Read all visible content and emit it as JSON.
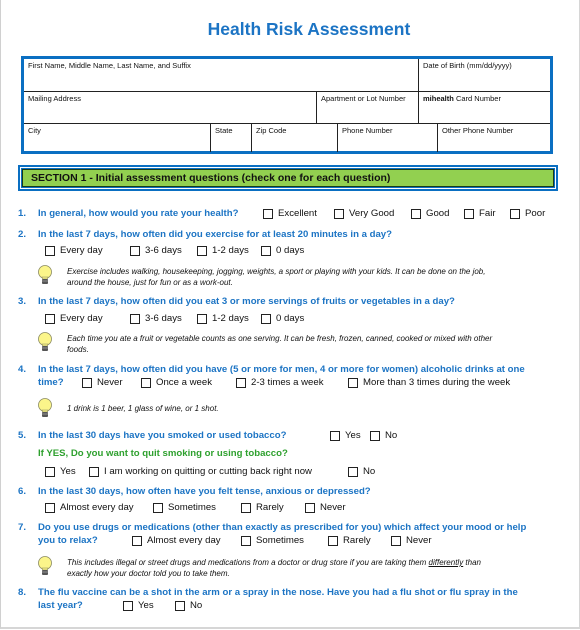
{
  "title": "Health Risk Assessment",
  "info_fields": {
    "full_name": "First Name, Middle Name, Last Name, and Suffix",
    "dob": "Date of Birth (mm/dd/yyyy)",
    "mailing_address": "Mailing Address",
    "apartment": "Apartment or Lot Number",
    "card_number_brand": "mihealth",
    "card_number_rest": "Card Number",
    "city": "City",
    "state": "State",
    "zip": "Zip Code",
    "phone": "Phone Number",
    "other_phone": "Other Phone Number"
  },
  "section": {
    "title": "SECTION 1 - Initial assessment questions (check one for each question)"
  },
  "questions": [
    {
      "num": "1.",
      "text": "In general, how would you rate your health?",
      "options": [
        "Excellent",
        "Very Good",
        "Good",
        "Fair",
        "Poor"
      ]
    },
    {
      "num": "2.",
      "text": "In the last 7 days, how often did you exercise for at least 20 minutes in a day?",
      "options": [
        "Every day",
        "3-6 days",
        "1-2 days",
        "0 days"
      ],
      "tip": [
        "Exercise includes walking, housekeeping, jogging, weights, a sport or playing with your kids.  It can be done on the job,",
        "around the house, just for fun or as a work-out."
      ]
    },
    {
      "num": "3.",
      "text": "In the last 7 days, how often did you eat 3 or more servings of fruits or vegetables in a day?",
      "options": [
        "Every day",
        "3-6 days",
        "1-2 days",
        "0 days"
      ],
      "tip": [
        "Each time you ate a fruit or vegetable counts as one serving.  It can be fresh, frozen, canned, cooked or mixed with other",
        "foods."
      ]
    },
    {
      "num": "4.",
      "text_line1": "In the last 7 days, how often did you have (5 or more for men, 4 or more for women) alcoholic drinks at one",
      "text_line2": "time?",
      "options": [
        "Never",
        "Once a week",
        "2-3 times a week",
        "More than 3 times during the week"
      ],
      "tip": [
        "1 drink is 1 beer, 1 glass of wine, or 1 shot."
      ]
    },
    {
      "num": "5.",
      "text": "In the last 30 days have you smoked or used tobacco?",
      "options": [
        "Yes",
        "No"
      ],
      "followup": {
        "text": "If YES, Do you want to quit smoking or using tobacco?",
        "options": [
          "Yes",
          "I am working on quitting or cutting back right now",
          "No"
        ]
      }
    },
    {
      "num": "6.",
      "text": "In the last 30 days, how often have you felt tense, anxious or depressed?",
      "options": [
        "Almost every day",
        "Sometimes",
        "Rarely",
        "Never"
      ]
    },
    {
      "num": "7.",
      "text_line1": "Do you use drugs or medications (other than exactly as prescribed for you) which affect your mood or help",
      "text_line2": "you to relax?",
      "options": [
        "Almost every day",
        "Sometimes",
        "Rarely",
        "Never"
      ],
      "tip_a": "This includes illegal or street drugs and medications from a doctor or drug store if you are taking them ",
      "tip_u": "differently",
      "tip_b": " than",
      "tip_line2": "exactly how your doctor told you to take them."
    },
    {
      "num": "8.",
      "text_line1": "The flu vaccine can be a shot in the arm or a spray in the nose.  Have you had a flu shot or flu spray in the",
      "text_line2": "last year?",
      "options": [
        "Yes",
        "No"
      ]
    }
  ]
}
